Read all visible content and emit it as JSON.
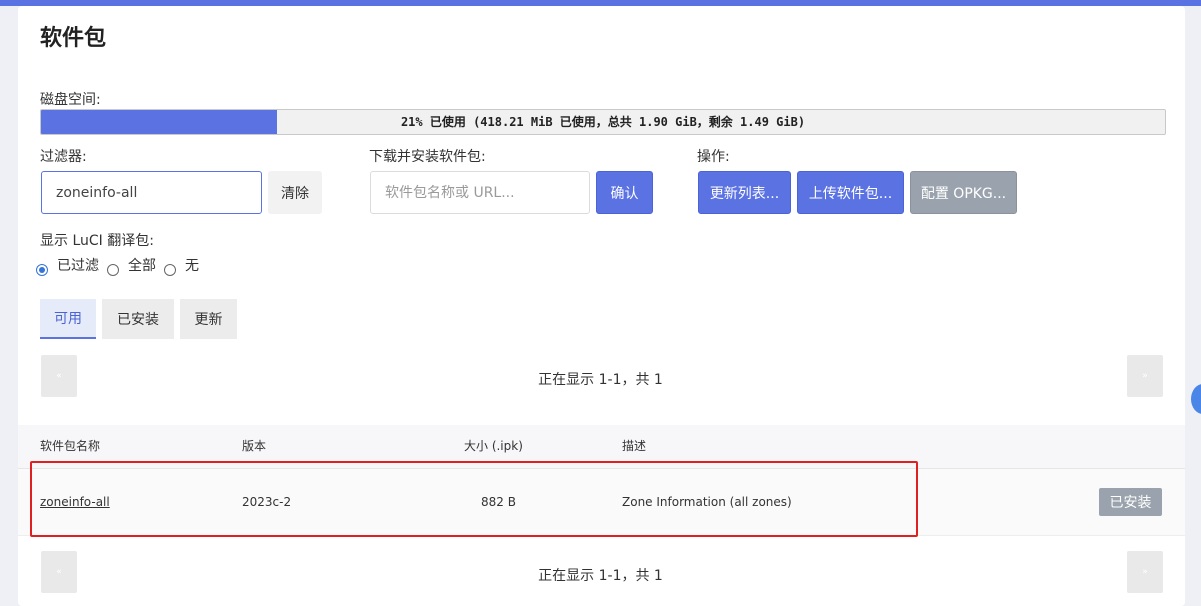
{
  "page": {
    "title": "软件包"
  },
  "disk": {
    "label": "磁盘空间:",
    "used_percent": 21,
    "text": "21% 已使用 (418.21 MiB 已使用，总共 1.90 GiB，剩余 1.49 GiB)"
  },
  "filter": {
    "label": "过滤器:",
    "value": "zoneinfo-all",
    "clear_label": "清除"
  },
  "download": {
    "label": "下载并安装软件包:",
    "placeholder": "软件包名称或 URL...",
    "confirm_label": "确认"
  },
  "actions": {
    "label": "操作:",
    "update_lists": "更新列表...",
    "upload_package": "上传软件包...",
    "configure_opkg": "配置 OPKG..."
  },
  "translations": {
    "label": "显示 LuCI 翻译包:",
    "options": [
      {
        "label": "已过滤",
        "checked": true
      },
      {
        "label": "全部",
        "checked": false
      },
      {
        "label": "无",
        "checked": false
      }
    ]
  },
  "tabs": [
    {
      "label": "可用",
      "active": true
    },
    {
      "label": "已安装",
      "active": false
    },
    {
      "label": "更新",
      "active": false
    }
  ],
  "pager": {
    "text": "正在显示 1-1，共 1",
    "prev_glyph": "«",
    "next_glyph": "»"
  },
  "table": {
    "headers": [
      "软件包名称",
      "版本",
      "大小 (.ipk)",
      "描述"
    ],
    "rows": [
      {
        "name": "zoneinfo-all",
        "version": "2023c-2",
        "size": "882 B",
        "description": "Zone Information (all zones)",
        "action": "已安装"
      }
    ]
  }
}
